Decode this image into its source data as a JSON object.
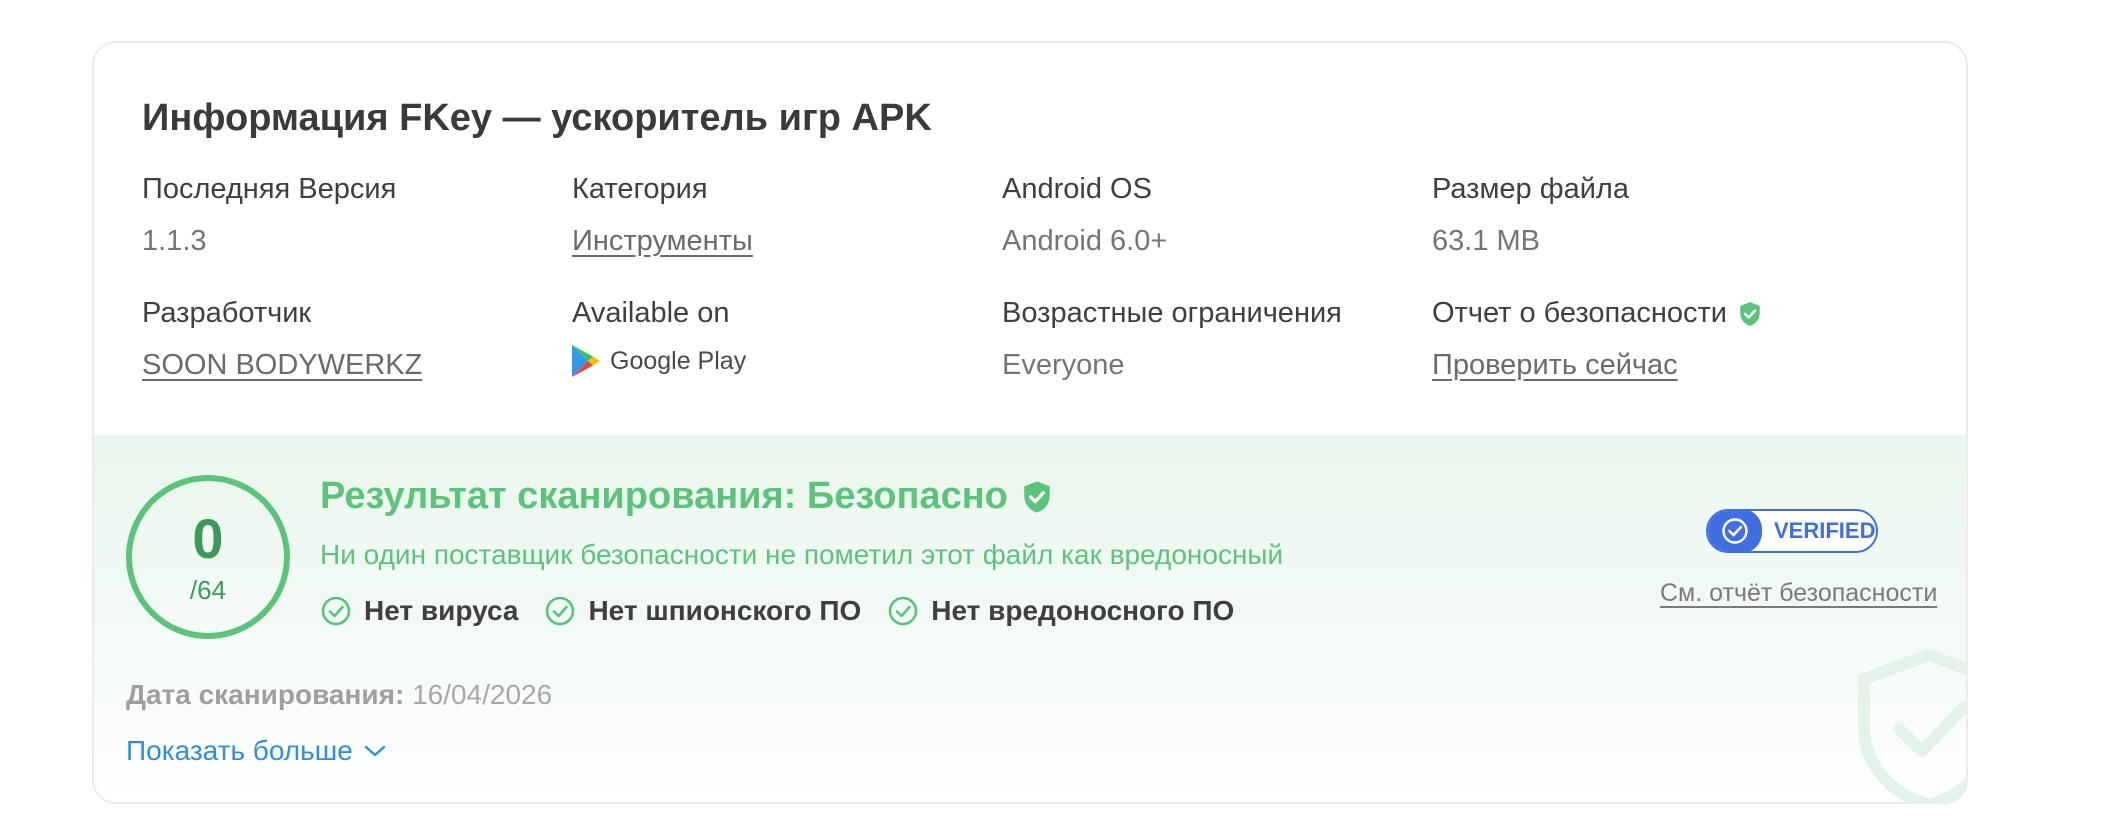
{
  "card": {
    "title": "Информация FKey — ускоритель игр APK",
    "info": {
      "version_label": "Последняя Версия",
      "version_value": "1.1.3",
      "category_label": "Категория",
      "category_value": "Инструменты",
      "os_label": "Android OS",
      "os_value": "Android 6.0+",
      "size_label": "Размер файла",
      "size_value": "63.1 MB",
      "developer_label": "Разработчик",
      "developer_value": "SOON BODYWERKZ",
      "available_label": "Available on",
      "available_value": "Google Play",
      "age_label": "Возрастные ограничения",
      "age_value": "Everyone",
      "security_label": "Отчет о безопасности",
      "security_value": "Проверить сейчас"
    }
  },
  "scan": {
    "detected": "0",
    "total": "/64",
    "title": "Результат сканирования: Безопасно",
    "subtitle": "Ни один поставщик безопасности не пометил этот файл как вредоносный",
    "checks": [
      {
        "label": "Нет вируса",
        "icon": "check-circle-icon"
      },
      {
        "label": "Нет шпионского ПО",
        "icon": "check-circle-icon"
      },
      {
        "label": "Нет вредоносного ПО",
        "icon": "check-circle-icon"
      }
    ],
    "verified_label": "VERIFIED",
    "report_link": "См. отчёт безопасности",
    "date_label": "Дата сканирования:",
    "date_value": "16/04/2026",
    "show_more": "Показать больше"
  },
  "colors": {
    "safe_green": "#5bc47a",
    "verified_blue": "#3f6fe0",
    "link_blue": "#2f8fdc",
    "text_dark": "#3f3f3f",
    "text_muted": "#757575"
  }
}
